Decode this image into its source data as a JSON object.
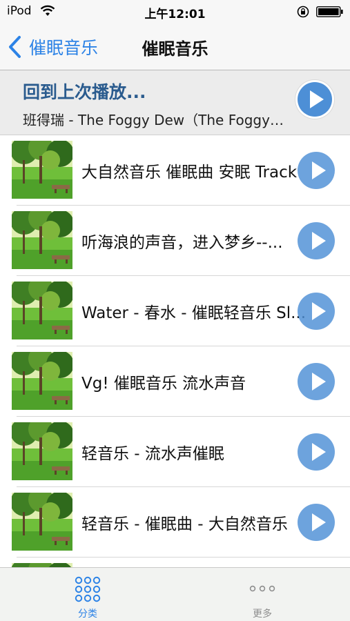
{
  "status_bar": {
    "carrier": "iPod",
    "time": "上午12:01"
  },
  "nav": {
    "back_label": "催眠音乐",
    "title": "催眠音乐"
  },
  "resume": {
    "title": "回到上次播放...",
    "subtitle": "班得瑞 - The Foggy Dew（The Foggy Dew）"
  },
  "tracks": [
    {
      "title": "大自然音乐 催眠曲 安眠 Track"
    },
    {
      "title": "听海浪的声音，进入梦乡--..."
    },
    {
      "title": "Water - 春水 - 催眠轻音乐 Sl..."
    },
    {
      "title": "Vg! 催眠音乐 流水声音"
    },
    {
      "title": "轻音乐 - 流水声催眠"
    },
    {
      "title": "轻音乐 - 催眠曲 - 大自然音乐"
    }
  ],
  "tab_bar": {
    "tabs": [
      {
        "label": "分类",
        "icon": "grid-icon",
        "active": true
      },
      {
        "label": "更多",
        "icon": "more-dots-icon",
        "active": false
      }
    ]
  },
  "colors": {
    "accent": "#2d83e6",
    "resume_title": "#2a5b8e",
    "play_button": "#4d8fd6"
  }
}
